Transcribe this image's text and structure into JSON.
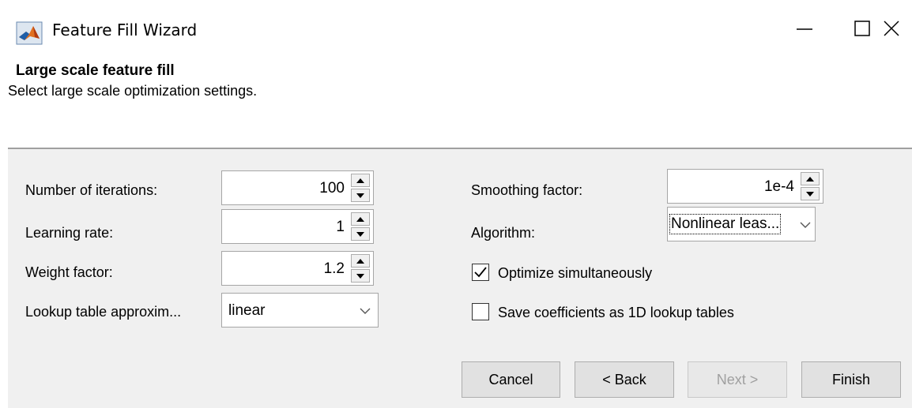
{
  "window": {
    "title": "Feature Fill Wizard",
    "app_icon": "matlab-logo-icon",
    "controls": [
      "minimize-icon",
      "maximize-icon",
      "close-icon"
    ]
  },
  "header": {
    "heading": "Large scale feature fill",
    "description": "Select large scale optimization settings."
  },
  "left_settings": {
    "iterations_label": "Number of iterations:",
    "iterations_value": "100",
    "learning_rate_label": "Learning rate:",
    "learning_rate_value": "1",
    "weight_factor_label": "Weight factor:",
    "weight_factor_value": "1.2",
    "lookup_label": "Lookup table approxim...",
    "lookup_value": "linear"
  },
  "right_settings": {
    "smoothing_label": "Smoothing factor:",
    "smoothing_value": "1e-4",
    "algorithm_label": "Algorithm:",
    "algorithm_value": "Nonlinear leas...",
    "optimize_label": "Optimize simultaneously",
    "optimize_checked": true,
    "save_coeff_label": "Save coefficients as 1D lookup tables",
    "save_coeff_checked": false
  },
  "buttons": {
    "cancel": "Cancel",
    "back": "< Back",
    "next": "Next >",
    "next_enabled": false,
    "finish": "Finish"
  },
  "colors": {
    "panel_bg": "#f0f0f0",
    "button_bg": "#e1e1e1",
    "disabled_text": "#a0a0a0"
  }
}
